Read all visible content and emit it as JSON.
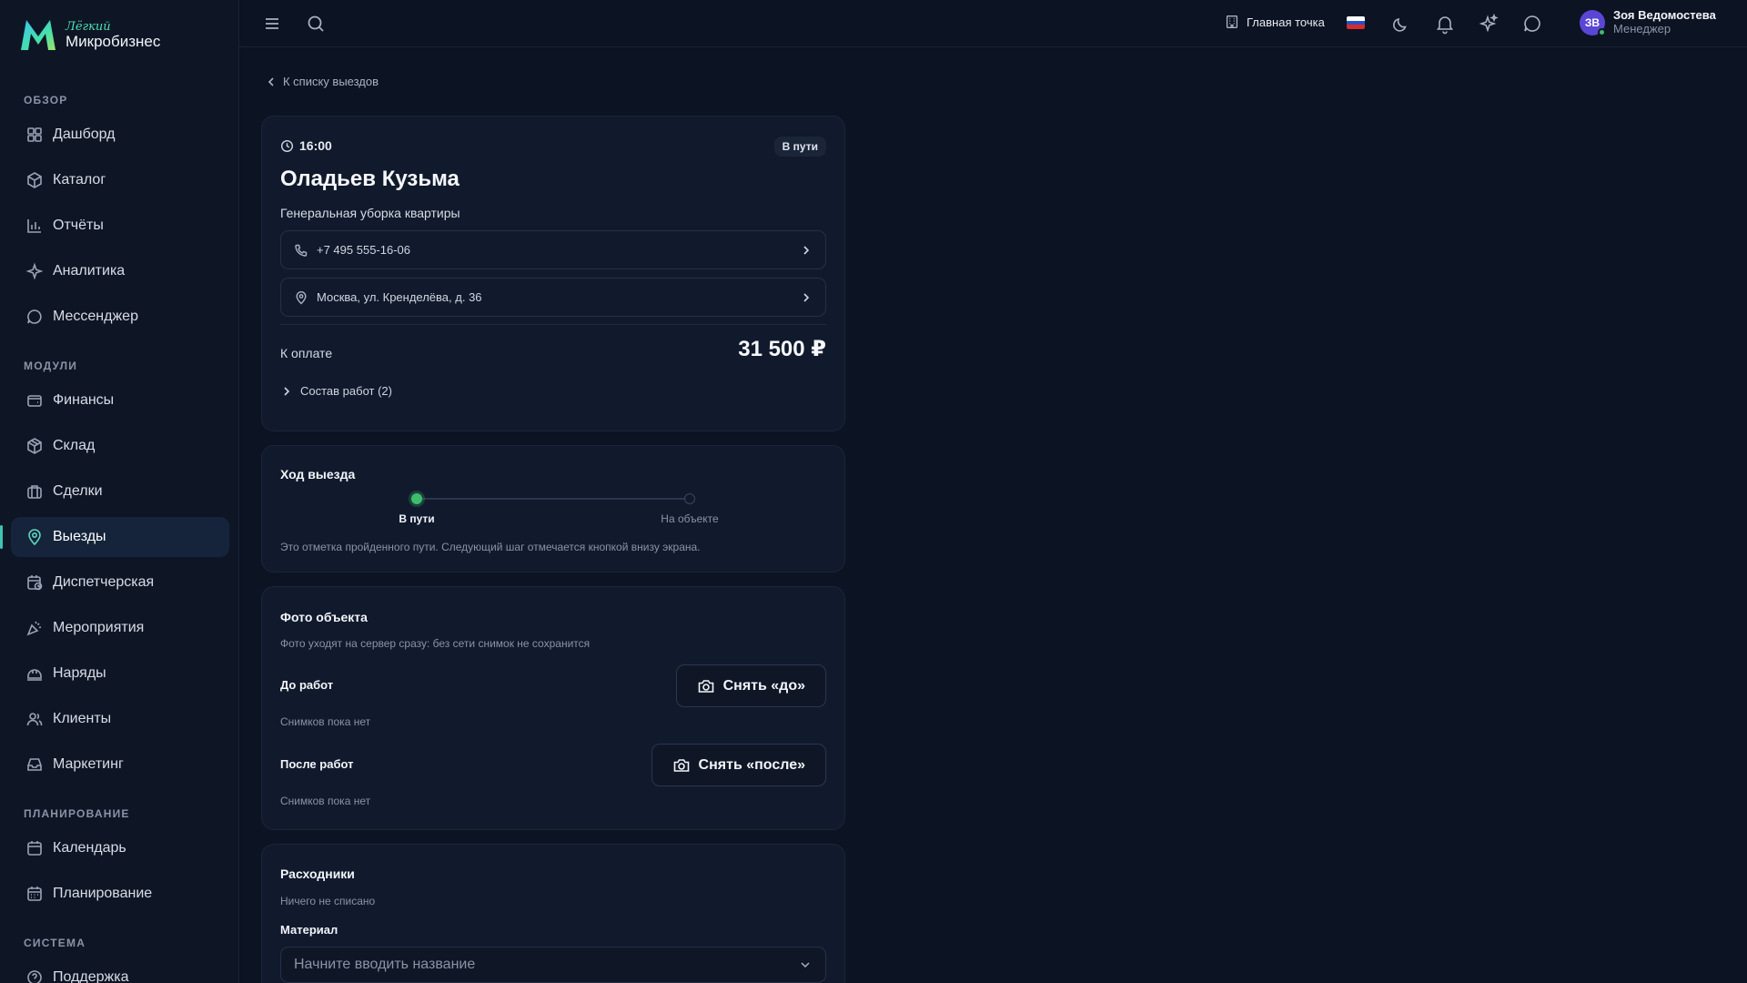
{
  "brand": {
    "sub": "Лёгкий",
    "name": "Микробизнес"
  },
  "sidebar": {
    "sections": [
      {
        "label": "Обзор",
        "items": [
          {
            "label": "Дашборд",
            "icon": "dashboard-icon"
          },
          {
            "label": "Каталог",
            "icon": "catalog-icon"
          },
          {
            "label": "Отчёты",
            "icon": "reports-icon"
          },
          {
            "label": "Аналитика",
            "icon": "sparkle-icon"
          },
          {
            "label": "Мессенджер",
            "icon": "chat-icon"
          }
        ]
      },
      {
        "label": "Модули",
        "items": [
          {
            "label": "Финансы",
            "icon": "wallet-icon"
          },
          {
            "label": "Склад",
            "icon": "box-icon"
          },
          {
            "label": "Сделки",
            "icon": "briefcase-icon"
          },
          {
            "label": "Выезды",
            "icon": "map-pin-icon",
            "active": true
          },
          {
            "label": "Диспетчерская",
            "icon": "calendar-clock-icon"
          },
          {
            "label": "Мероприятия",
            "icon": "party-icon"
          },
          {
            "label": "Наряды",
            "icon": "hard-hat-icon"
          },
          {
            "label": "Клиенты",
            "icon": "users-icon"
          },
          {
            "label": "Маркетинг",
            "icon": "inbox-icon"
          }
        ]
      },
      {
        "label": "Планирование",
        "items": [
          {
            "label": "Календарь",
            "icon": "calendar-icon"
          },
          {
            "label": "Планирование",
            "icon": "calendar-grid-icon"
          }
        ]
      },
      {
        "label": "Система",
        "items": [
          {
            "label": "Поддержка",
            "icon": "help-icon"
          }
        ]
      }
    ]
  },
  "topbar": {
    "branch": "Главная точка",
    "user": {
      "initials": "ЗВ",
      "name": "Зоя Ведомостева",
      "role": "Менеджер"
    }
  },
  "back_link": "К списку выездов",
  "visit": {
    "time": "16:00",
    "status": "В пути",
    "client": "Оладьев Кузьма",
    "service": "Генеральная уборка квартиры",
    "phone": "+7 495 555-16-06",
    "address": "Москва, ул. Кренделёва, д. 36",
    "pay_label": "К оплате",
    "pay_amount": "31 500 ₽",
    "works_label": "Состав работ (2)"
  },
  "progress": {
    "title": "Ход выезда",
    "steps": [
      {
        "label": "В пути",
        "done": true
      },
      {
        "label": "На объекте",
        "done": false
      }
    ],
    "hint": "Это отметка пройденного пути. Следующий шаг отмечается кнопкой внизу экрана."
  },
  "photos": {
    "title": "Фото объекта",
    "hint": "Фото уходят на сервер сразу: без сети снимок не сохранится",
    "before": {
      "label": "До работ",
      "button": "Снять «до»",
      "empty": "Снимков пока нет"
    },
    "after": {
      "label": "После работ",
      "button": "Снять «после»",
      "empty": "Снимков пока нет"
    }
  },
  "consumables": {
    "title": "Расходники",
    "empty": "Ничего не списано",
    "field_label": "Материал",
    "placeholder": "Начните вводить название"
  },
  "colors": {
    "accent": "#40c4b0",
    "success": "#3dbd6b",
    "background": "#0c1323",
    "card": "#111a2c"
  }
}
